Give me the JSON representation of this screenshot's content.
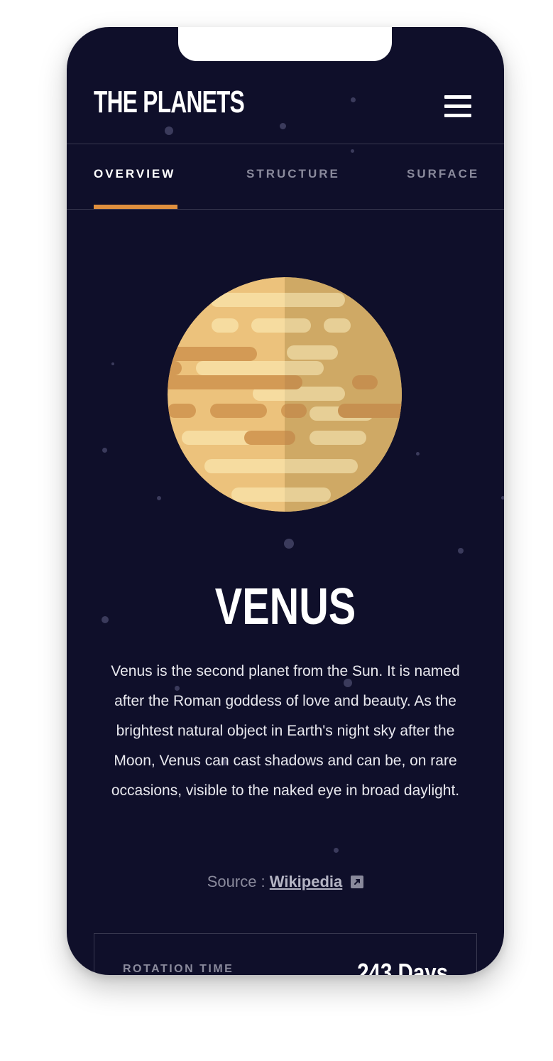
{
  "app": {
    "title": "THE PLANETS",
    "menu_icon": "hamburger-icon"
  },
  "tabs": [
    {
      "label": "OVERVIEW",
      "active": true
    },
    {
      "label": "STRUCTURE",
      "active": false
    },
    {
      "label": "SURFACE",
      "active": false
    }
  ],
  "colors": {
    "accent": "#df8f3e",
    "background": "#0f0f2a",
    "planet": "#ecc27c"
  },
  "planet": {
    "name": "VENUS",
    "description": "Venus is the second planet from the Sun. It is named after the Roman goddess of love and beauty. As the brightest natural object in Earth's night sky after the Moon, Venus can cast shadows and can be, on rare occasions, visible to the naked eye in broad daylight.",
    "source_prefix": "Source : ",
    "source_link": "Wikipedia",
    "source_icon": "external-link-icon"
  },
  "stats": [
    {
      "label": "ROTATION TIME",
      "value": "243 Days"
    }
  ]
}
